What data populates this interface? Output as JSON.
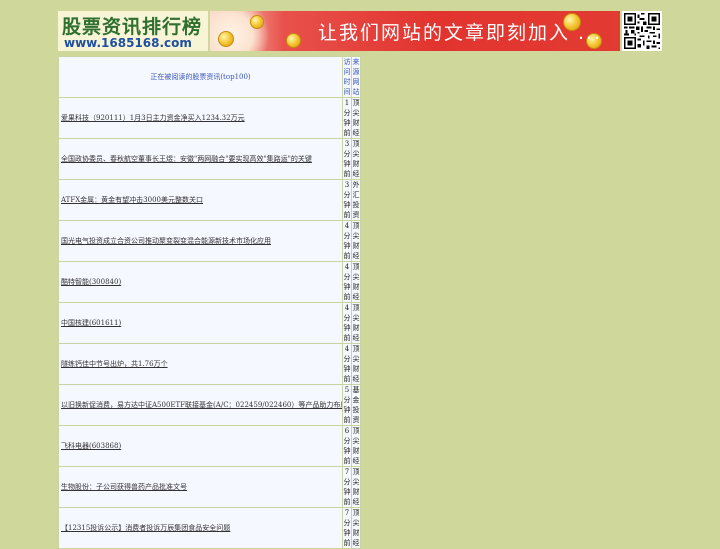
{
  "header": {
    "logo_title": "股票资讯排行榜",
    "logo_url": "www.1685168.com",
    "banner_text": "让我们网站的文章即刻加入 ..."
  },
  "table": {
    "title": "正在被阅读的股票资讯(top100)",
    "col_time": "访问时间",
    "col_source": "来源网站",
    "rows": [
      {
        "title": "爱果科技（920111）1月3日主力资金净买入1234.32万元",
        "time": "1分钟前",
        "source": "顶尖财经"
      },
      {
        "title": "全国政协委员、春秋航空董事长王煜：安徽\"两网融合\"要实现高效\"集路运\"的关键",
        "time": "3分钟前",
        "source": "顶尖财经"
      },
      {
        "title": "ATFX金属：黄金有望冲击3000美元整数关口",
        "time": "3分钟前",
        "source": "外汇投资"
      },
      {
        "title": "国光电气投资成立合资公司推动聚变裂变混合能源新技术市场化应用",
        "time": "4分钟前",
        "source": "顶尖财经"
      },
      {
        "title": "酷特智能(300840)",
        "time": "4分钟前",
        "source": "顶尖财经"
      },
      {
        "title": "中国核建(601611)",
        "time": "4分钟前",
        "source": "顶尖财经"
      },
      {
        "title": "隧练钙佳中节号出炉，共1.76万个",
        "time": "4分钟前",
        "source": "顶尖财经"
      },
      {
        "title": "以旧换新促消费，易方达中证A500ETF联接基金(A/C：022459/022460）等产品助力布局A股资产",
        "time": "5分钟前",
        "source": "基金投资"
      },
      {
        "title": "飞科电器(603868)",
        "time": "6分钟前",
        "source": "顶尖财经"
      },
      {
        "title": "生物股份：子公司获得兽药产品批准文号",
        "time": "7分钟前",
        "source": "顶尖财经"
      },
      {
        "title": "【12315投诉公示】消费者投诉万辰集团食品安全问题",
        "time": "7分钟前",
        "source": "顶尖财经"
      }
    ]
  },
  "colors": {
    "page_bg": "#cfd89a",
    "table_bg": "#f6f8ff",
    "link_blue": "#3553b7",
    "banner_red": "#e2342f"
  }
}
